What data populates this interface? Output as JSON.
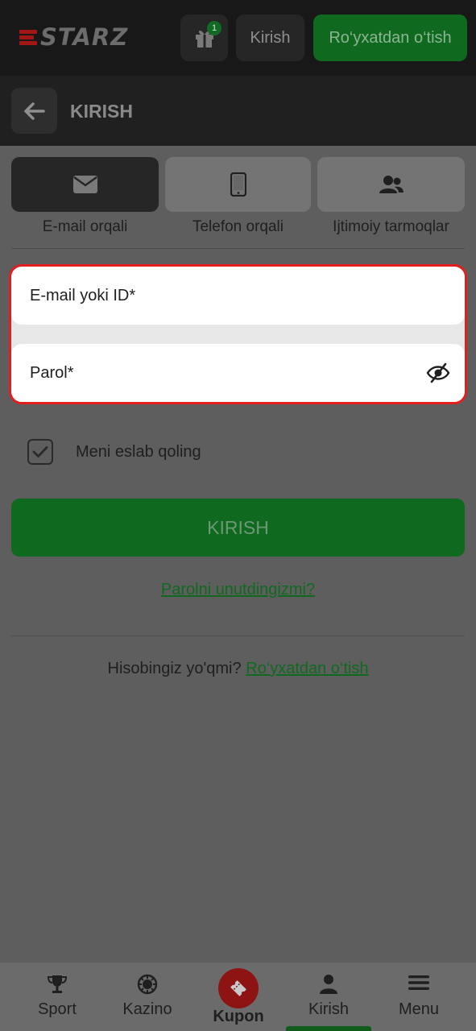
{
  "header": {
    "logo_text": "STARZ",
    "gift_badge": "1",
    "login_label": "Kirish",
    "register_label": "Ro‘yxatdan o‘tish"
  },
  "subheader": {
    "title": "KIRISH"
  },
  "tabs": [
    {
      "label": "E-mail orqali",
      "icon": "envelope-icon",
      "active": true
    },
    {
      "label": "Telefon orqali",
      "icon": "smartphone-icon",
      "active": false
    },
    {
      "label": "Ijtimoiy tarmoqlar",
      "icon": "users-icon",
      "active": false
    }
  ],
  "form": {
    "email_placeholder": "E-mail yoki ID*",
    "email_value": "",
    "password_placeholder": "Parol*",
    "password_value": "",
    "remember_label": "Meni eslab qoling",
    "remember_checked": true,
    "submit_label": "KIRISH",
    "forgot_label": "Parolni unutdingizmi?",
    "no_account_text": "Hisobingiz yo'qmi?",
    "register_link": "Ro‘yxatdan o‘tish"
  },
  "bottom_nav": [
    {
      "label": "Sport",
      "icon": "trophy-icon"
    },
    {
      "label": "Kazino",
      "icon": "casino-chip-icon"
    },
    {
      "label": "Kupon",
      "icon": "ticket-icon"
    },
    {
      "label": "Kirish",
      "icon": "user-icon",
      "active": true
    },
    {
      "label": "Menu",
      "icon": "hamburger-icon"
    }
  ],
  "colors": {
    "accent_green": "#0f6a1f",
    "highlight_red": "#e21e1e",
    "kupon_red": "#8e1414"
  }
}
